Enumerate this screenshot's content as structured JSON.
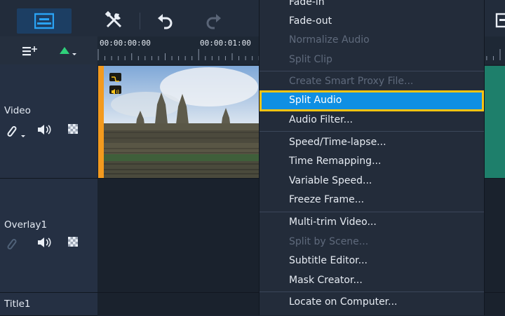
{
  "toolbar": {
    "buttons": [
      {
        "name": "timeline-view",
        "icon": "timeline-view-icon",
        "active": true
      },
      {
        "name": "tools",
        "icon": "tools-icon"
      },
      {
        "name": "undo",
        "icon": "undo-icon"
      },
      {
        "name": "redo",
        "icon": "redo-icon",
        "enabled": false
      }
    ],
    "accent": "#1e9bf0"
  },
  "ruler": {
    "timecodes": [
      "00:00:00:00",
      "00:00:01:00"
    ]
  },
  "tracks": [
    {
      "label": "Video",
      "icons": [
        "link-icon",
        "speaker-icon",
        "grid-icon"
      ]
    },
    {
      "label": "Overlay1",
      "icons": [
        "link-icon",
        "speaker-icon",
        "grid-icon"
      ]
    },
    {
      "label": "Title1"
    }
  ],
  "clip": {
    "name": "Angkor Wat temple photo",
    "edge_color": "#f39a1e",
    "next_clip_color": "#1e7f6b"
  },
  "context_menu": {
    "items": [
      {
        "label": "Fade-in",
        "enabled": true
      },
      {
        "label": "Fade-out",
        "enabled": true
      },
      {
        "label": "Normalize Audio",
        "enabled": false
      },
      {
        "label": "Split Clip",
        "enabled": false
      },
      {
        "label": "Create Smart Proxy File...",
        "enabled": false
      },
      {
        "label": "Split Audio",
        "enabled": true,
        "selected": true
      },
      {
        "label": "Audio Filter...",
        "enabled": true
      },
      {
        "label": "Speed/Time-lapse...",
        "enabled": true
      },
      {
        "label": "Time Remapping...",
        "enabled": true
      },
      {
        "label": "Variable Speed...",
        "enabled": true
      },
      {
        "label": "Freeze Frame...",
        "enabled": true
      },
      {
        "label": "Multi-trim Video...",
        "enabled": true
      },
      {
        "label": "Split by Scene...",
        "enabled": false
      },
      {
        "label": "Subtitle Editor...",
        "enabled": true
      },
      {
        "label": "Mask Creator...",
        "enabled": true
      },
      {
        "label": "Locate on Computer...",
        "enabled": true
      }
    ],
    "highlight_color": "#0f8fe3",
    "focus_ring_color": "#f6c313"
  }
}
